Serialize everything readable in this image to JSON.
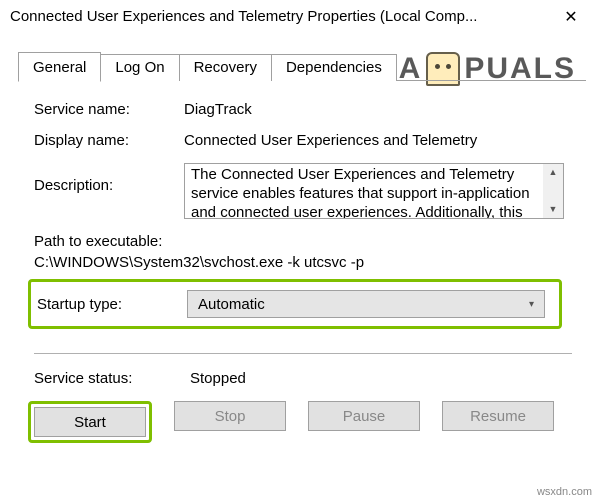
{
  "window": {
    "title": "Connected User Experiences and Telemetry Properties (Local Comp..."
  },
  "tabs": {
    "general": "General",
    "logon": "Log On",
    "recovery": "Recovery",
    "dependencies": "Dependencies"
  },
  "fields": {
    "service_name_label": "Service name:",
    "service_name_value": "DiagTrack",
    "display_name_label": "Display name:",
    "display_name_value": "Connected User Experiences and Telemetry",
    "description_label": "Description:",
    "description_value": "The Connected User Experiences and Telemetry service enables features that support in-application and connected user experiences. Additionally, this",
    "path_label": "Path to executable:",
    "path_value": "C:\\WINDOWS\\System32\\svchost.exe -k utcsvc -p",
    "startup_label": "Startup type:",
    "startup_value": "Automatic",
    "status_label": "Service status:",
    "status_value": "Stopped"
  },
  "buttons": {
    "start": "Start",
    "stop": "Stop",
    "pause": "Pause",
    "resume": "Resume"
  },
  "watermark": {
    "left": "A",
    "right": "PUALS"
  },
  "credit": "wsxdn.com"
}
